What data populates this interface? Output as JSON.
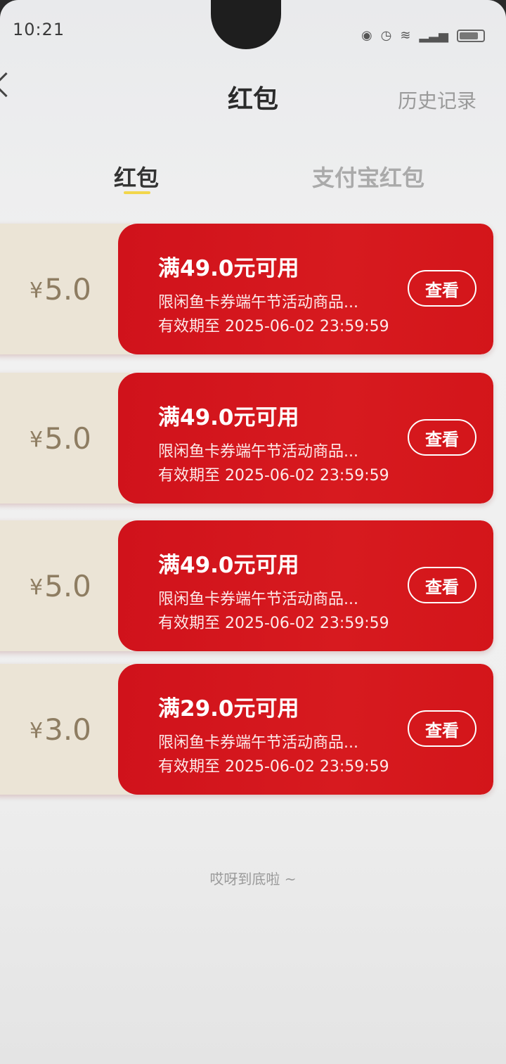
{
  "status_bar": {
    "time": "10:21"
  },
  "header": {
    "title": "红包",
    "history": "历史记录"
  },
  "tabs": [
    {
      "label": "红包",
      "active": true
    },
    {
      "label": "支付宝红包",
      "active": false
    }
  ],
  "coupons": [
    {
      "currency": "¥",
      "amount": "5.0",
      "condition": "满49.0元可用",
      "description": "限闲鱼卡券端午节活动商品...",
      "expiry": "有效期至 2025-06-02 23:59:59",
      "button": "查看"
    },
    {
      "currency": "¥",
      "amount": "5.0",
      "condition": "满49.0元可用",
      "description": "限闲鱼卡券端午节活动商品...",
      "expiry": "有效期至 2025-06-02 23:59:59",
      "button": "查看"
    },
    {
      "currency": "¥",
      "amount": "5.0",
      "condition": "满49.0元可用",
      "description": "限闲鱼卡券端午节活动商品...",
      "expiry": "有效期至 2025-06-02 23:59:59",
      "button": "查看"
    },
    {
      "currency": "¥",
      "amount": "3.0",
      "condition": "满29.0元可用",
      "description": "限闲鱼卡券端午节活动商品...",
      "expiry": "有效期至 2025-06-02 23:59:59",
      "button": "查看"
    }
  ],
  "footer": {
    "end_text": "哎呀到底啦 ~"
  },
  "colors": {
    "coupon_red": "#d0121b",
    "coupon_stub": "#ebe4d6",
    "tab_indicator": "#f2d64b"
  }
}
